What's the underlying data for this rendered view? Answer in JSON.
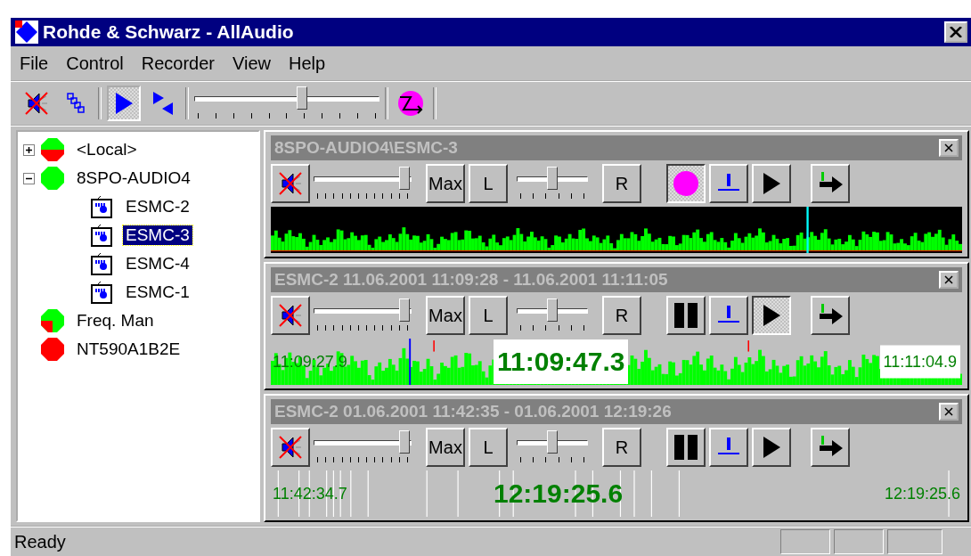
{
  "window": {
    "title": "Rohde & Schwarz - AllAudio"
  },
  "menu": [
    "File",
    "Control",
    "Recorder",
    "View",
    "Help"
  ],
  "toolbar": {
    "play_pressed": true,
    "level": 0.58
  },
  "tree": [
    {
      "label": "<Local>",
      "kind": "split",
      "expanded": false,
      "selected": false
    },
    {
      "label": "8SPO-AUDIO4",
      "kind": "ok",
      "expanded": true,
      "selected": false,
      "children": [
        {
          "label": "ESMC-2",
          "kind": "device",
          "selected": false
        },
        {
          "label": "ESMC-3",
          "kind": "device",
          "selected": true
        },
        {
          "label": "ESMC-4",
          "kind": "device",
          "selected": false
        },
        {
          "label": "ESMC-1",
          "kind": "device",
          "selected": false
        }
      ]
    },
    {
      "label": "Freq. Man",
      "kind": "quarter",
      "selected": false
    },
    {
      "label": "NT590A1B2E",
      "kind": "error",
      "selected": false
    }
  ],
  "panels": [
    {
      "title": "8SPO-AUDIO4\\ESMC-3",
      "volume": {
        "level": 0.93
      },
      "balance": {
        "level": 0.5
      },
      "buttons": [
        "Max",
        "L",
        "R"
      ],
      "transport": {
        "kind": "record",
        "pressed": true
      },
      "play_pressed": false,
      "wave": {
        "kind": "live"
      }
    },
    {
      "title": "ESMC-2 11.06.2001 11:09:28 - 11.06.2001 11:11:05",
      "volume": {
        "level": 0.93
      },
      "balance": {
        "level": 0.5
      },
      "buttons": [
        "Max",
        "L",
        "R"
      ],
      "transport": {
        "kind": "pause",
        "pressed": false
      },
      "play_pressed": true,
      "wave": {
        "kind": "playback"
      },
      "start": "11:09:27.9",
      "current": "11:09:47.3",
      "end": "11:11:04.9"
    },
    {
      "title": "ESMC-2 01.06.2001 11:42:35 - 01.06.2001 12:19:26",
      "volume": {
        "level": 0.93
      },
      "balance": {
        "level": 0.5
      },
      "buttons": [
        "Max",
        "L",
        "R"
      ],
      "transport": {
        "kind": "pause",
        "pressed": false
      },
      "play_pressed": false,
      "wave": {
        "kind": "index"
      },
      "start": "11:42:34.7",
      "current": "12:19:25.6",
      "end": "12:19:25.6"
    }
  ],
  "status_bar": {
    "text": "Ready"
  }
}
